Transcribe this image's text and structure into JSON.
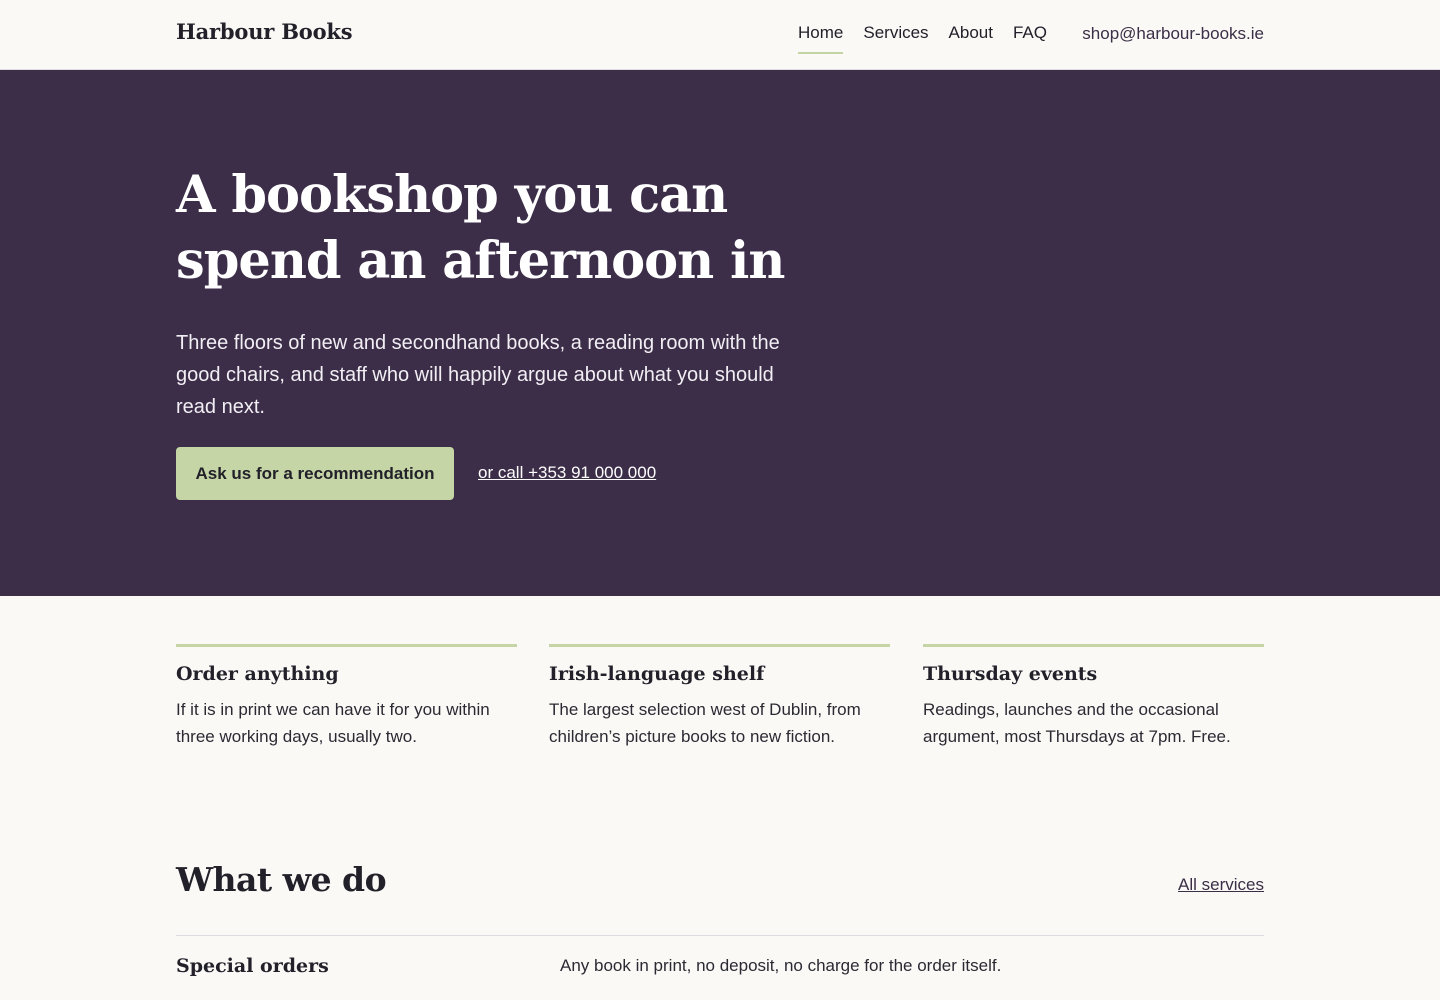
{
  "header": {
    "brand": "Harbour Books",
    "nav": [
      {
        "label": "Home",
        "active": true
      },
      {
        "label": "Services",
        "active": false
      },
      {
        "label": "About",
        "active": false
      },
      {
        "label": "FAQ",
        "active": false
      }
    ],
    "email": "shop@harbour-books.ie"
  },
  "hero": {
    "title": "A bookshop you can spend an afternoon in",
    "lede": "Three floors of new and secondhand books, a reading room with the good chairs, and staff who will happily argue about what you should read next.",
    "cta_label": "Ask us for a recommendation",
    "call_label": "or call +353 91 000 000"
  },
  "features": [
    {
      "title": "Order anything",
      "text": "If it is in print we can have it for you within three working days, usually two."
    },
    {
      "title": "Irish-language shelf",
      "text": "The largest selection west of Dublin, from children’s picture books to new fiction."
    },
    {
      "title": "Thursday events",
      "text": "Readings, launches and the occasional argument, most Thursdays at 7pm. Free."
    }
  ],
  "services": {
    "title": "What we do",
    "all_link": "All services",
    "items": [
      {
        "name": "Special orders",
        "desc": "Any book in print, no deposit, no charge for the order itself."
      }
    ]
  },
  "colors": {
    "hero_bg": "#3c2e48",
    "accent": "#c6d5a6",
    "page_bg": "#faf9f6"
  }
}
